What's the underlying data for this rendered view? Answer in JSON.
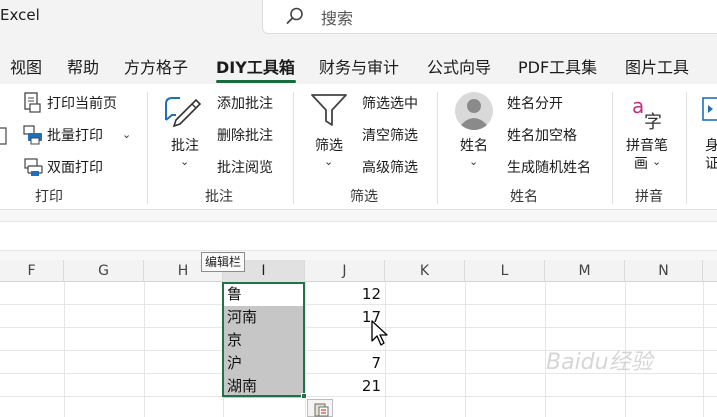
{
  "app": {
    "name": "Excel"
  },
  "search": {
    "placeholder": "搜索"
  },
  "tabs": [
    {
      "label": "视图"
    },
    {
      "label": "帮助"
    },
    {
      "label": "方方格子"
    },
    {
      "label": "DIY工具箱"
    },
    {
      "label": "财务与审计"
    },
    {
      "label": "公式向导"
    },
    {
      "label": "PDF工具集"
    },
    {
      "label": "图片工具"
    }
  ],
  "ribbon": {
    "print": {
      "current_page": "打印当前页",
      "batch_print": "批量打印",
      "duplex_print": "双面打印",
      "group": "打印"
    },
    "comment": {
      "big": "批注",
      "add": "添加批注",
      "delete": "删除批注",
      "read": "批注阅览",
      "group": "批注"
    },
    "filter": {
      "big": "筛选",
      "filter_selected": "筛选选中",
      "clear_filter": "清空筛选",
      "advanced": "高级筛选",
      "group": "筛选"
    },
    "name": {
      "big": "姓名",
      "split": "姓名分开",
      "add_space": "姓名加空格",
      "random": "生成随机姓名",
      "group": "姓名"
    },
    "pinyin": {
      "big1": "拼音笔",
      "big2": "画",
      "group": "拼音",
      "icon_a": "a",
      "icon_char": "字"
    },
    "partial": {
      "top": "身",
      "bottom": "证"
    }
  },
  "columns": [
    "F",
    "G",
    "H",
    "I",
    "J",
    "K",
    "L",
    "M",
    "N"
  ],
  "tooltip": "编辑栏",
  "rows": [
    {
      "i": "鲁",
      "j": "12"
    },
    {
      "i": "河南",
      "j": "17"
    },
    {
      "i": "京",
      "j": ""
    },
    {
      "i": "沪",
      "j": "7"
    },
    {
      "i": "湖南",
      "j": "21"
    }
  ],
  "colors": {
    "accent": "#217346",
    "tab_underline": "#1a6b3c",
    "selection": "#c6c6c6"
  },
  "watermark": "Baidu经验"
}
